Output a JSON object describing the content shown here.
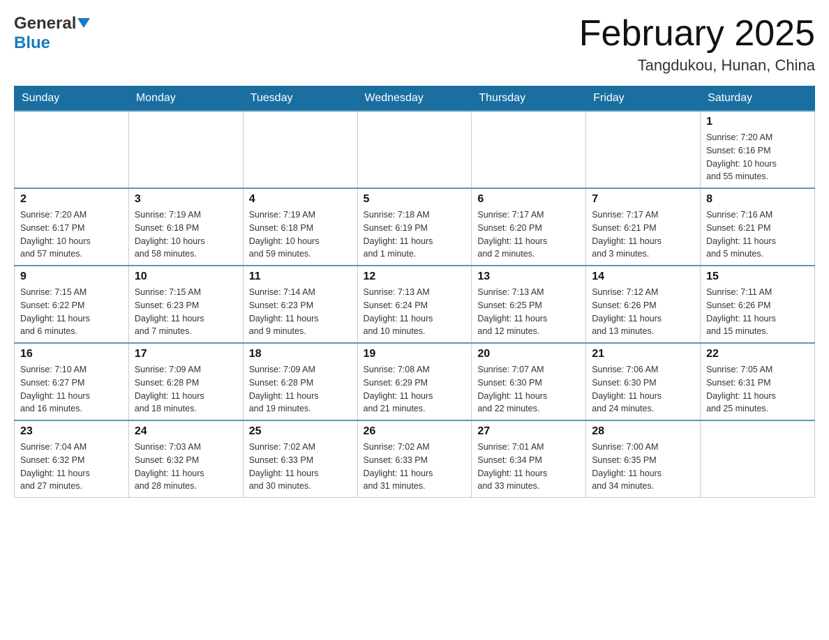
{
  "header": {
    "logo_general": "General",
    "logo_blue": "Blue",
    "title": "February 2025",
    "subtitle": "Tangdukou, Hunan, China"
  },
  "days_of_week": [
    "Sunday",
    "Monday",
    "Tuesday",
    "Wednesday",
    "Thursday",
    "Friday",
    "Saturday"
  ],
  "weeks": [
    [
      {
        "day": "",
        "info": ""
      },
      {
        "day": "",
        "info": ""
      },
      {
        "day": "",
        "info": ""
      },
      {
        "day": "",
        "info": ""
      },
      {
        "day": "",
        "info": ""
      },
      {
        "day": "",
        "info": ""
      },
      {
        "day": "1",
        "info": "Sunrise: 7:20 AM\nSunset: 6:16 PM\nDaylight: 10 hours\nand 55 minutes."
      }
    ],
    [
      {
        "day": "2",
        "info": "Sunrise: 7:20 AM\nSunset: 6:17 PM\nDaylight: 10 hours\nand 57 minutes."
      },
      {
        "day": "3",
        "info": "Sunrise: 7:19 AM\nSunset: 6:18 PM\nDaylight: 10 hours\nand 58 minutes."
      },
      {
        "day": "4",
        "info": "Sunrise: 7:19 AM\nSunset: 6:18 PM\nDaylight: 10 hours\nand 59 minutes."
      },
      {
        "day": "5",
        "info": "Sunrise: 7:18 AM\nSunset: 6:19 PM\nDaylight: 11 hours\nand 1 minute."
      },
      {
        "day": "6",
        "info": "Sunrise: 7:17 AM\nSunset: 6:20 PM\nDaylight: 11 hours\nand 2 minutes."
      },
      {
        "day": "7",
        "info": "Sunrise: 7:17 AM\nSunset: 6:21 PM\nDaylight: 11 hours\nand 3 minutes."
      },
      {
        "day": "8",
        "info": "Sunrise: 7:16 AM\nSunset: 6:21 PM\nDaylight: 11 hours\nand 5 minutes."
      }
    ],
    [
      {
        "day": "9",
        "info": "Sunrise: 7:15 AM\nSunset: 6:22 PM\nDaylight: 11 hours\nand 6 minutes."
      },
      {
        "day": "10",
        "info": "Sunrise: 7:15 AM\nSunset: 6:23 PM\nDaylight: 11 hours\nand 7 minutes."
      },
      {
        "day": "11",
        "info": "Sunrise: 7:14 AM\nSunset: 6:23 PM\nDaylight: 11 hours\nand 9 minutes."
      },
      {
        "day": "12",
        "info": "Sunrise: 7:13 AM\nSunset: 6:24 PM\nDaylight: 11 hours\nand 10 minutes."
      },
      {
        "day": "13",
        "info": "Sunrise: 7:13 AM\nSunset: 6:25 PM\nDaylight: 11 hours\nand 12 minutes."
      },
      {
        "day": "14",
        "info": "Sunrise: 7:12 AM\nSunset: 6:26 PM\nDaylight: 11 hours\nand 13 minutes."
      },
      {
        "day": "15",
        "info": "Sunrise: 7:11 AM\nSunset: 6:26 PM\nDaylight: 11 hours\nand 15 minutes."
      }
    ],
    [
      {
        "day": "16",
        "info": "Sunrise: 7:10 AM\nSunset: 6:27 PM\nDaylight: 11 hours\nand 16 minutes."
      },
      {
        "day": "17",
        "info": "Sunrise: 7:09 AM\nSunset: 6:28 PM\nDaylight: 11 hours\nand 18 minutes."
      },
      {
        "day": "18",
        "info": "Sunrise: 7:09 AM\nSunset: 6:28 PM\nDaylight: 11 hours\nand 19 minutes."
      },
      {
        "day": "19",
        "info": "Sunrise: 7:08 AM\nSunset: 6:29 PM\nDaylight: 11 hours\nand 21 minutes."
      },
      {
        "day": "20",
        "info": "Sunrise: 7:07 AM\nSunset: 6:30 PM\nDaylight: 11 hours\nand 22 minutes."
      },
      {
        "day": "21",
        "info": "Sunrise: 7:06 AM\nSunset: 6:30 PM\nDaylight: 11 hours\nand 24 minutes."
      },
      {
        "day": "22",
        "info": "Sunrise: 7:05 AM\nSunset: 6:31 PM\nDaylight: 11 hours\nand 25 minutes."
      }
    ],
    [
      {
        "day": "23",
        "info": "Sunrise: 7:04 AM\nSunset: 6:32 PM\nDaylight: 11 hours\nand 27 minutes."
      },
      {
        "day": "24",
        "info": "Sunrise: 7:03 AM\nSunset: 6:32 PM\nDaylight: 11 hours\nand 28 minutes."
      },
      {
        "day": "25",
        "info": "Sunrise: 7:02 AM\nSunset: 6:33 PM\nDaylight: 11 hours\nand 30 minutes."
      },
      {
        "day": "26",
        "info": "Sunrise: 7:02 AM\nSunset: 6:33 PM\nDaylight: 11 hours\nand 31 minutes."
      },
      {
        "day": "27",
        "info": "Sunrise: 7:01 AM\nSunset: 6:34 PM\nDaylight: 11 hours\nand 33 minutes."
      },
      {
        "day": "28",
        "info": "Sunrise: 7:00 AM\nSunset: 6:35 PM\nDaylight: 11 hours\nand 34 minutes."
      },
      {
        "day": "",
        "info": ""
      }
    ]
  ]
}
